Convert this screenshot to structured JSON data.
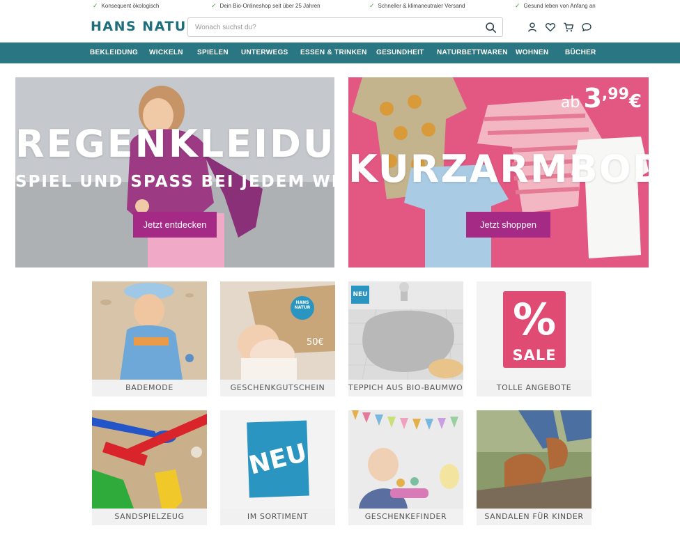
{
  "usp": [
    "Konsequent ökologisch",
    "Dein Bio-Onlineshop seit über 25 Jahren",
    "Schneller & klimaneutraler Versand",
    "Gesund leben von Anfang an"
  ],
  "header": {
    "logo": "HANS NATUR",
    "search_placeholder": "Wonach suchst du?",
    "icons": [
      "user-icon",
      "heart-icon",
      "cart-icon",
      "chat-icon"
    ]
  },
  "nav": [
    "BEKLEIDUNG",
    "WICKELN",
    "SPIELEN",
    "UNTERWEGS",
    "ESSEN & TRINKEN",
    "GESUNDHEIT",
    "NATURBETTWAREN",
    "WOHNEN",
    "BÜCHER"
  ],
  "banners": {
    "left": {
      "title": "REGENKLEIDUNG",
      "subtitle": "SPIEL UND SPAß BEI JEDEM WETTER",
      "cta": "Jetzt entdecken"
    },
    "right": {
      "title": "KURZARMBODYS",
      "price_prefix": "ab",
      "price_main": "3",
      "price_cents": ",99",
      "price_currency": "€",
      "cta": "Jetzt shoppen"
    }
  },
  "tiles": [
    {
      "label": "BADEMODE"
    },
    {
      "label": "GESCHENKGUTSCHEIN",
      "card_logo": "HANS NATUR",
      "card_value": "50€"
    },
    {
      "label": "TEPPICH AUS BIO-BAUMWOLLE",
      "badge": "NEU"
    },
    {
      "label": "TOLLE ANGEBOTE",
      "sale_symbol": "%",
      "sale_text": "SALE"
    },
    {
      "label": "SANDSPIELZEUG"
    },
    {
      "label": "IM SORTIMENT",
      "badge": "NEU"
    },
    {
      "label": "GESCHENKEFINDER"
    },
    {
      "label": "SANDALEN FÜR KINDER"
    }
  ],
  "colors": {
    "brand": "#2a7683",
    "cta": "#a52a86",
    "sale": "#e04b73",
    "neu": "#2a95c0",
    "banner_pink": "#e35882"
  }
}
